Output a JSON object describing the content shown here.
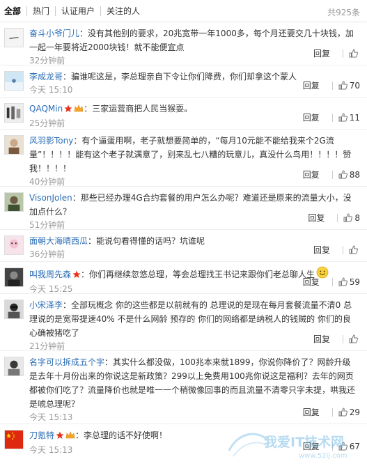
{
  "tabs": [
    "全部",
    "热门",
    "认证用户",
    "关注的人"
  ],
  "total": "共925条",
  "reply_label": "回复",
  "watermark": {
    "title": "我爱IT技术网",
    "url": "www.52ij.com"
  },
  "comments": [
    {
      "user": "奋斗小爷门儿",
      "text": "没有其他别的要求，20兆宽带一年1000多，每个月还要交几十块钱，加一起一年要将近2000块钱！就不能便宜点",
      "time": "32分钟前",
      "likes": ""
    },
    {
      "user": "李成龙哥",
      "text": "骗谁呢这是，李总理亲自下令让你们降费，你们却拿这个蒙人",
      "time": "今天 15:10",
      "likes": "70"
    },
    {
      "user": "QAQMin",
      "text": "三家运营商把人民当猴耍。",
      "time": "25分钟前",
      "likes": "11"
    },
    {
      "user": "风羽影Tony",
      "text": "有个逼蛋用啊，老子就想要简单的，“每月10元能不能给我来个2G流量”！！！！能有这个老子就满意了，别来乱七八糟的玩意儿，真没什么鸟用！！！！赞我！！！！",
      "time": "40分钟前",
      "likes": "88"
    },
    {
      "user": "VisonJolen",
      "text": "那些已经办理4G合约套餐的用户怎么办呢？难道还是原来的流量大小，没加点什么？",
      "time": "51分钟前",
      "likes": "8"
    },
    {
      "user": "面朝大海晴西瓜",
      "text": "能说句看得懂的话吗？坑谁呢",
      "time": "36分钟前",
      "likes": ""
    },
    {
      "user": "叫我周先森",
      "text": "你们再继续忽悠总理，等会总理找王书记来跟你们老总聊人生",
      "time": "今天 15:25",
      "likes": "59"
    },
    {
      "user": "小宋泽李",
      "text": "全部玩概念 你的这些都是以前就有的 总理说的是现在每月套餐流量不清0 总理说的是宽带提速40% 不是什么网龄 预存的 你们的网络都是纳税人的钱贼的 你们的良心确被猪吃了",
      "time": "21分钟前",
      "likes": ""
    },
    {
      "user": "名字可以拆成五个字",
      "text": "其实什么都没做，100兆本来就1899，你说你降价了？网龄升级是去年十月份出来的你说这是新政策？299以上免费用100兆你说这是福利？去年的网页都被你们吃了？流量降价也就是唯一一个稍微像回事的而且流量不清零只字未提，哄我还是唬总理呢？",
      "time": "今天 15:13",
      "likes": "29"
    },
    {
      "user": "刀氪特",
      "text": "李总理的话不好使啊！",
      "time": "今天 15:13",
      "likes": "67"
    }
  ]
}
